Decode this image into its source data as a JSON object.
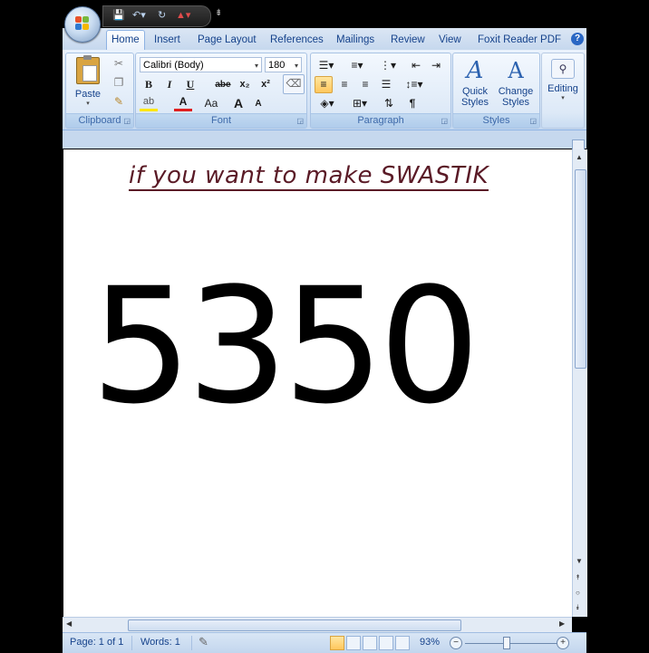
{
  "tabs": [
    "Home",
    "Insert",
    "Page Layout",
    "References",
    "Mailings",
    "Review",
    "View",
    "Foxit Reader PDF"
  ],
  "active_tab": "Home",
  "ribbon": {
    "clipboard": {
      "label": "Clipboard",
      "paste": "Paste"
    },
    "font": {
      "label": "Font",
      "font_name": "Calibri (Body)",
      "font_size": "180",
      "bold": "B",
      "italic": "I",
      "underline": "U",
      "strike": "abe",
      "subscript": "x₂",
      "superscript": "x²",
      "change_case": "Aa",
      "grow": "A",
      "shrink": "A"
    },
    "paragraph": {
      "label": "Paragraph",
      "pilcrow": "¶"
    },
    "styles": {
      "label": "Styles",
      "quick_styles": [
        "Quick",
        "Styles"
      ],
      "change_styles": [
        "Change",
        "Styles"
      ]
    },
    "editing": {
      "label": "Editing"
    }
  },
  "document": {
    "title": "if you want to make SWASTIK",
    "number": "5350"
  },
  "status": {
    "page": "Page: 1 of 1",
    "words": "Words: 1",
    "zoom": "93%"
  },
  "colors": {
    "title": "#5a1a26",
    "ribbon": "#dbe6f4",
    "accent": "#15428b"
  }
}
